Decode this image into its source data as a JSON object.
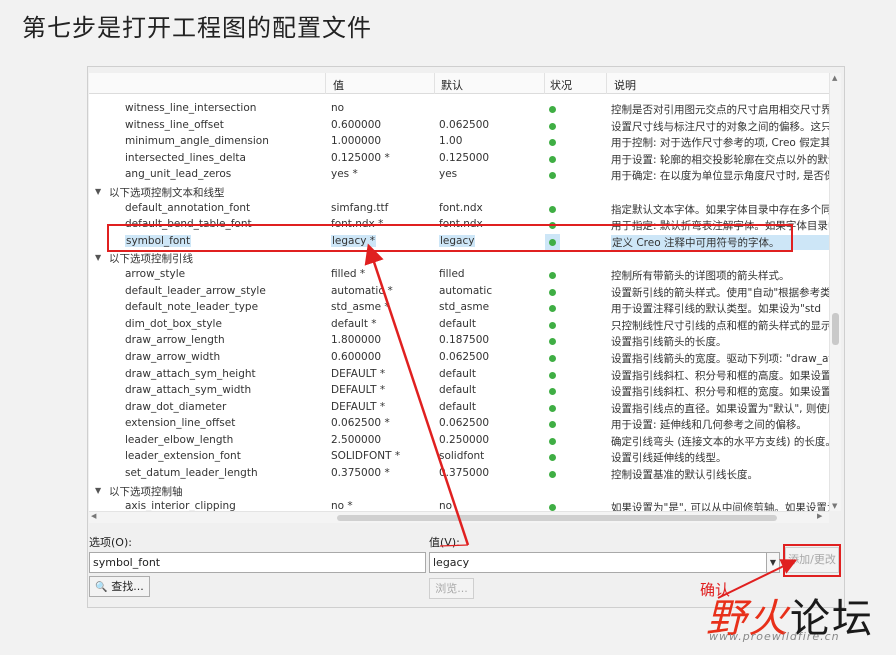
{
  "heading": "第七步是打开工程图的配置文件",
  "columns": {
    "value": "值",
    "default": "默认",
    "status": "状况",
    "description": "说明"
  },
  "rows": [
    {
      "type": "item",
      "name": "witness_line_intersection",
      "value": "no",
      "default": "",
      "desc": "控制是否对引用图元交点的尺寸启用相交尺寸界线"
    },
    {
      "type": "item",
      "name": "witness_line_offset",
      "value": "0.600000",
      "default": "0.062500",
      "desc": "设置尺寸线与标注尺寸的对象之间的偏移。这只有"
    },
    {
      "type": "item",
      "name": "minimum_angle_dimension",
      "value": "1.000000",
      "default": "1.00",
      "desc": "用于控制: 对于选作尺寸参考的项, Creo 假定其平"
    },
    {
      "type": "item",
      "name": "intersected_lines_delta",
      "value": "0.125000 *",
      "default": "0.125000",
      "desc": "用于设置: 轮廓的相交投影轮廓在交点以外的默认投"
    },
    {
      "type": "item",
      "name": "ang_unit_lead_zeros",
      "value": "yes *",
      "default": "yes",
      "desc": "用于确定: 在以度为单位显示角度尺寸时, 是否保留"
    },
    {
      "type": "group",
      "label": "以下选项控制文本和线型"
    },
    {
      "type": "item",
      "name": "default_annotation_font",
      "value": "simfang.ttf",
      "default": "font.ndx",
      "desc": "指定默认文本字体。如果字体目录中存在多个同名"
    },
    {
      "type": "item",
      "name": "default_bend_table_font",
      "value": "font.ndx *",
      "default": "font.ndx",
      "desc": "用于指定: 默认折弯表注解字体。如果字体目录中存"
    },
    {
      "type": "item",
      "name": "symbol_font",
      "value": "legacy *",
      "default": "legacy",
      "desc": "定义 Creo 注释中可用符号的字体。",
      "selected": true
    },
    {
      "type": "group",
      "label": "以下选项控制引线"
    },
    {
      "type": "item",
      "name": "arrow_style",
      "value": "filled *",
      "default": "filled",
      "desc": "控制所有带箭头的详图项的箭头样式。"
    },
    {
      "type": "item",
      "name": "default_leader_arrow_style",
      "value": "automatic *",
      "default": "automatic",
      "desc": "设置新引线的箭头样式。使用\"自动\"根据参考类型"
    },
    {
      "type": "item",
      "name": "default_note_leader_type",
      "value": "std_asme *",
      "default": "std_asme",
      "desc": "用于设置注释引线的默认类型。如果设为\"std"
    },
    {
      "type": "item",
      "name": "dim_dot_box_style",
      "value": "default *",
      "default": "default",
      "desc": "只控制线性尺寸引线的点和框的箭头样式的显示。"
    },
    {
      "type": "item",
      "name": "draw_arrow_length",
      "value": "1.800000",
      "default": "0.187500",
      "desc": "设置指引线箭头的长度。"
    },
    {
      "type": "item",
      "name": "draw_arrow_width",
      "value": "0.600000",
      "default": "0.062500",
      "desc": "设置指引线箭头的宽度。驱动下列项: \"draw_attac"
    },
    {
      "type": "item",
      "name": "draw_attach_sym_height",
      "value": "DEFAULT *",
      "default": "default",
      "desc": "设置指引线斜杠、积分号和框的高度。如果设置为"
    },
    {
      "type": "item",
      "name": "draw_attach_sym_width",
      "value": "DEFAULT *",
      "default": "default",
      "desc": "设置指引线斜杠、积分号和框的宽度。如果设置为"
    },
    {
      "type": "item",
      "name": "draw_dot_diameter",
      "value": "DEFAULT *",
      "default": "default",
      "desc": "设置指引线点的直径。如果设置为\"默认\", 则使用"
    },
    {
      "type": "item",
      "name": "extension_line_offset",
      "value": "0.062500 *",
      "default": "0.062500",
      "desc": "用于设置: 延伸线和几何参考之间的偏移。"
    },
    {
      "type": "item",
      "name": "leader_elbow_length",
      "value": "2.500000",
      "default": "0.250000",
      "desc": "确定引线弯头 (连接文本的水平方支线) 的长度。"
    },
    {
      "type": "item",
      "name": "leader_extension_font",
      "value": "SOLIDFONT *",
      "default": "solidfont",
      "desc": "设置引线延伸线的线型。"
    },
    {
      "type": "item",
      "name": "set_datum_leader_length",
      "value": "0.375000 *",
      "default": "0.375000",
      "desc": "控制设置基准的默认引线长度。"
    },
    {
      "type": "group",
      "label": "以下选项控制轴"
    },
    {
      "type": "item",
      "name": "axis_interior_clipping",
      "value": "no *",
      "default": "no",
      "desc": "如果设置为\"是\", 可以从中间修剪轴。如果设置为\""
    }
  ],
  "option_label": "选项(O):",
  "option_value": "symbol_font",
  "value_label": "值(V):",
  "value_value": "legacy",
  "find_button": "查找...",
  "browse_button": "浏览...",
  "apply_button": "添加/更改",
  "confirm_annotation": "确认",
  "watermark": {
    "part1": "野",
    "part2": "火",
    "part3": "论坛",
    "url": "www.proewildfire.cn"
  },
  "colors": {
    "highlight": "#e02020",
    "status_ok": "#3fae44",
    "selection": "#cde6f7"
  }
}
